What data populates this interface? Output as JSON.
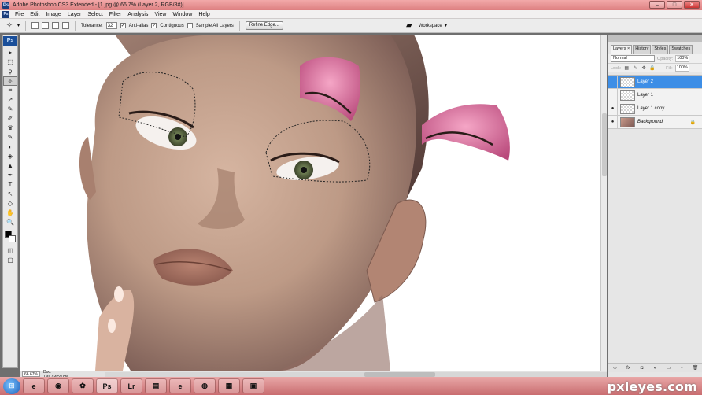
{
  "window": {
    "title": "Adobe Photoshop CS3 Extended - [1.jpg @ 66.7% (Layer 2, RGB/8#)]",
    "app_icon": "Ps",
    "controls": [
      "–",
      "□",
      "✕"
    ]
  },
  "menu": {
    "ps_icon": "Ps",
    "items": [
      "File",
      "Edit",
      "Image",
      "Layer",
      "Select",
      "Filter",
      "Analysis",
      "View",
      "Window",
      "Help"
    ]
  },
  "options": {
    "tolerance_label": "Tolerance:",
    "tolerance_value": "32",
    "anti_alias_label": "Anti-alias",
    "contiguous_label": "Contiguous",
    "sample_all_label": "Sample All Layers",
    "refine_label": "Refine Edge...",
    "workspace_label": "Workspace ▼"
  },
  "toolbox": {
    "logo": "Ps",
    "tools": [
      "▸",
      "⬚",
      "ϙ",
      "✧",
      "⌗",
      "↗",
      "✎",
      "✐",
      "♛",
      "✎",
      "◐",
      "◈",
      "▲",
      "✒",
      "T",
      "↖",
      "◇",
      "✋",
      "🔍"
    ],
    "active_index": 3
  },
  "status": {
    "zoom": "66.67%",
    "doc": "Doc: 190.7M/59.8M"
  },
  "layers_panel": {
    "tabs": [
      "Layers ×",
      "History",
      "Styles",
      "Swatches"
    ],
    "blend_mode": "Normal",
    "opacity_label": "Opacity:",
    "opacity_value": "100%",
    "lock_label": "Lock:",
    "fill_label": "Fill:",
    "fill_value": "100%",
    "layers": [
      {
        "name": "Layer 2",
        "visible": false,
        "selected": true
      },
      {
        "name": "Layer 1",
        "visible": false,
        "selected": false
      },
      {
        "name": "Layer 1 copy",
        "visible": true,
        "selected": false
      },
      {
        "name": "Background",
        "visible": true,
        "selected": false,
        "locked": true
      }
    ],
    "footer_icons": [
      "∞",
      "fx",
      "◘",
      "◐",
      "▭",
      "▫",
      "🗑"
    ]
  },
  "taskbar": {
    "start": "⊞",
    "buttons": [
      "e",
      "◉",
      "✿",
      "Ps",
      "Lr",
      "▤",
      "e",
      "◍",
      "▦",
      "▣"
    ],
    "active_button": 3
  },
  "watermark": "pxleyes.com",
  "colors": {
    "title_bar": "#dd7f80",
    "selected_layer": "#3d8ee6",
    "skin": "#c9a48f",
    "pink_piece": "#d97aa3"
  }
}
